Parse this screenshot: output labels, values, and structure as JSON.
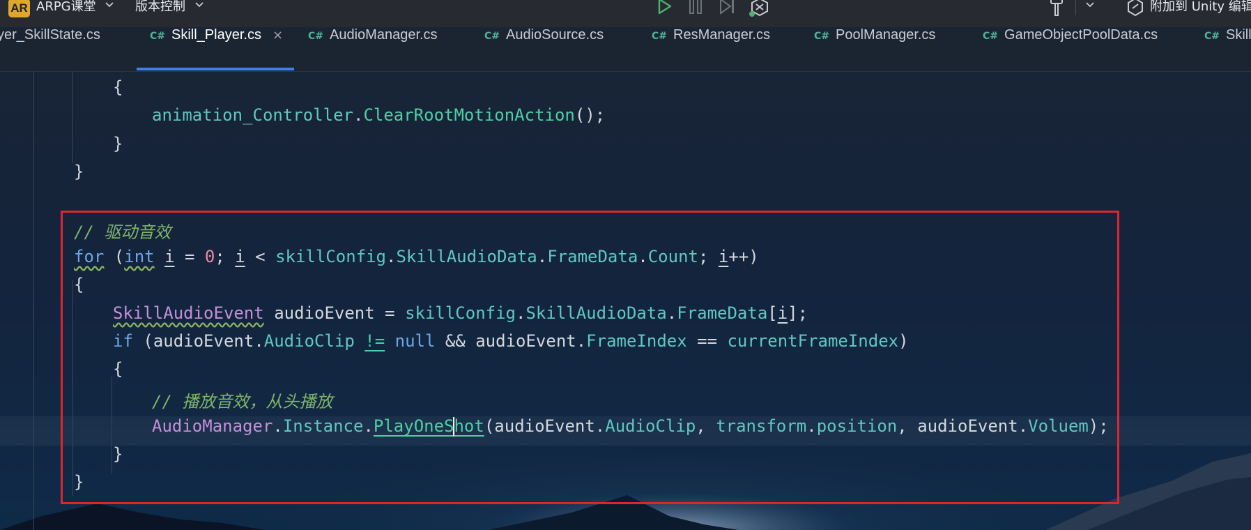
{
  "toolbar": {
    "project_badge": "AR",
    "project_name": "ARPG课堂",
    "vcs_label": "版本控制",
    "attach_label": "附加到 Unity 编辑",
    "icons": [
      "play-icon",
      "pause-icon",
      "step-icon",
      "debug-attach-icon",
      "build-hammer-icon",
      "chevron-down-icon",
      "attach-icon"
    ]
  },
  "tabs": [
    {
      "lang": "C#",
      "name": "yer_SkillState.cs",
      "active": false
    },
    {
      "lang": "C#",
      "name": "Skill_Player.cs",
      "active": true,
      "close": "×"
    },
    {
      "lang": "C#",
      "name": "AudioManager.cs",
      "active": false
    },
    {
      "lang": "C#",
      "name": "AudioSource.cs",
      "active": false
    },
    {
      "lang": "C#",
      "name": "ResManager.cs",
      "active": false
    },
    {
      "lang": "C#",
      "name": "PoolManager.cs",
      "active": false
    },
    {
      "lang": "C#",
      "name": "GameObjectPoolData.cs",
      "active": false
    },
    {
      "lang": "C#",
      "name": "Skill",
      "active": false
    }
  ],
  "code": {
    "l1": {
      "brace": "{"
    },
    "l2": {
      "obj": "animation_Controller",
      "dot": ".",
      "method": "ClearRootMotionAction",
      "rest": "();"
    },
    "l3": {
      "brace": "}"
    },
    "l4": {
      "brace": "}"
    },
    "l5": {
      "comment": "// 驱动音效"
    },
    "l6": {
      "kw_for": "for",
      "p1": " (",
      "kw_int": "int",
      "sp1": " ",
      "var_i": "i",
      "eq": " = ",
      "zero": "0",
      "semi1": "; ",
      "var_i2": "i",
      "lt": " < ",
      "cfg": "skillConfig",
      "d1": ".",
      "audio_data": "SkillAudioData",
      "d2": ".",
      "frame_data": "FrameData",
      "d3": ".",
      "count": "Count",
      "semi2": "; ",
      "var_i3": "i",
      "inc": "++)"
    },
    "l7": {
      "brace": "{"
    },
    "l8": {
      "type": "SkillAudioEvent",
      "sp": " ",
      "var": "audioEvent",
      "eq": " = ",
      "cfg": "skillConfig",
      "d1": ".",
      "audio_data": "SkillAudioData",
      "d2": ".",
      "frame_data": "FrameData",
      "b1": "[",
      "idx": "i",
      "b2": "];"
    },
    "l9": {
      "kw_if": "if",
      "p1": " (",
      "var": "audioEvent",
      "d1": ".",
      "clip": "AudioClip",
      "sp1": " ",
      "neq": "!=",
      "sp2": " ",
      "kw_null": "null",
      "and": " && ",
      "var2": "audioEvent",
      "d2": ".",
      "frame_index": "FrameIndex",
      "eqeq": " == ",
      "cur": "currentFrameIndex",
      "p2": ")"
    },
    "l10": {
      "brace": "{"
    },
    "l11": {
      "comment": "// 播放音效，从头播放"
    },
    "l12": {
      "cls": "AudioManager",
      "d1": ".",
      "inst": "Instance",
      "d2": ".",
      "meth_a": "PlayOneS",
      "meth_b": "hot",
      "p1": "(",
      "var": "audioEvent",
      "d3": ".",
      "clip": "AudioClip",
      "c1": ", ",
      "tf": "transform",
      "d4": ".",
      "pos": "position",
      "c2": ", ",
      "var2": "audioEvent",
      "d5": ".",
      "vol": "Voluem",
      "end": ");"
    },
    "l13": {
      "brace": "}"
    },
    "l14": {
      "brace": "}"
    }
  },
  "colors": {
    "accent_tab": "#3d80e6",
    "highlight_border": "#e0242c",
    "keyword": "#6ba7e8",
    "type": "#c590d8",
    "field": "#5fc8c0",
    "method": "#4ecfa6",
    "comment": "#80b56a",
    "number": "#eb8ba4",
    "badge": "#e0a72b"
  }
}
